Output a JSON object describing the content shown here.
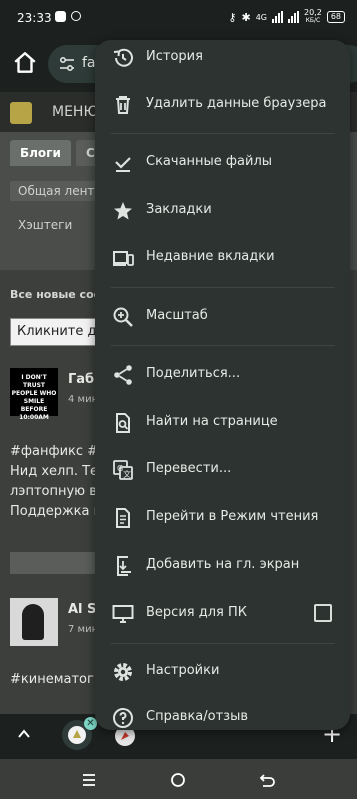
{
  "status_bar": {
    "time": "23:33",
    "network": "4G",
    "speed": "20,2",
    "speed_unit": "КБ/С",
    "battery": "68"
  },
  "toolbar": {
    "omnibox_text": "fan"
  },
  "page": {
    "menu_label": "МЕНЮ",
    "tabs": [
      "Блоги",
      "Со"
    ],
    "subtab": "Общая лента",
    "hashtags": "Хэштеги",
    "new_posts": "Все новые сооб",
    "click_box": "Кликните для",
    "post1": {
      "author": "Габи",
      "time": "4 мин",
      "avatar_text": "I DON'T TRUST PEOPLE WHO SMILE BEFORE 10:00AM",
      "lines": [
        "#фанфикс #ф",
        "Нид хелп. Тел",
        "лэптопную ве",
        "Поддержка м"
      ]
    },
    "post2": {
      "author": "Al Sa",
      "time": "7 мин",
      "tag": "#кинематогр"
    }
  },
  "menu": {
    "items": [
      {
        "label": "История",
        "icon": "history-icon"
      },
      {
        "label": "Удалить данные браузера",
        "icon": "trash-icon"
      },
      {
        "label": "Скачанные файлы",
        "icon": "download-check-icon"
      },
      {
        "label": "Закладки",
        "icon": "star-icon"
      },
      {
        "label": "Недавние вкладки",
        "icon": "devices-icon"
      },
      {
        "label": "Масштаб",
        "icon": "zoom-in-icon"
      },
      {
        "label": "Поделиться...",
        "icon": "share-icon"
      },
      {
        "label": "Найти на странице",
        "icon": "find-in-page-icon"
      },
      {
        "label": "Перевести...",
        "icon": "translate-icon"
      },
      {
        "label": "Перейти в Режим чтения",
        "icon": "reading-mode-icon"
      },
      {
        "label": "Добавить на гл. экран",
        "icon": "add-to-home-icon"
      },
      {
        "label": "Версия для ПК",
        "icon": "desktop-icon",
        "checked": false
      },
      {
        "label": "Настройки",
        "icon": "gear-icon"
      },
      {
        "label": "Справка/отзыв",
        "icon": "help-icon"
      }
    ]
  },
  "colors": {
    "menu_bg": "#2c3331",
    "omnibox_bg": "#2e3b38",
    "accent": "#7fd8c7"
  }
}
